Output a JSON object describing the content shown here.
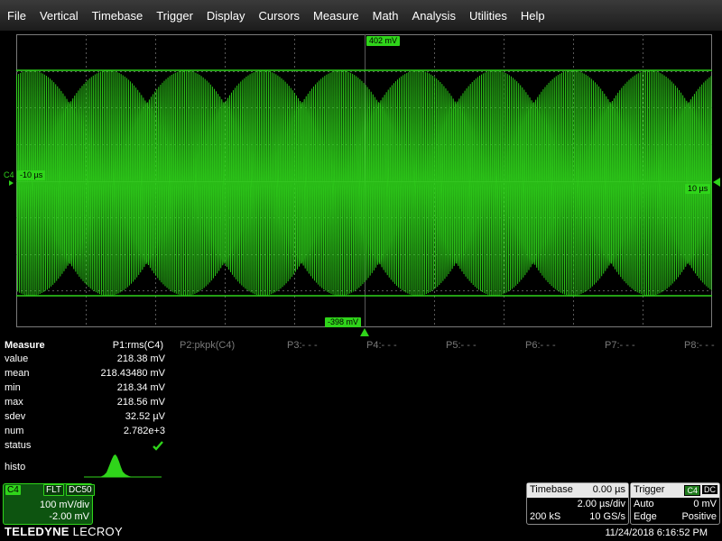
{
  "menu": [
    "File",
    "Vertical",
    "Timebase",
    "Trigger",
    "Display",
    "Cursors",
    "Measure",
    "Math",
    "Analysis",
    "Utilities",
    "Help"
  ],
  "grid": {
    "top_marker": "402 mV",
    "bottom_marker": "-398 mV",
    "channel_label": "C4",
    "left_time": "-10 µs",
    "right_time": "10 µs",
    "colors": {
      "trace": "#2fd41a",
      "grid": "#5a5a5a",
      "tag": "#2fd41a"
    }
  },
  "measure": {
    "title": "Measure",
    "p1": "P1:rms(C4)",
    "params": [
      "P2:pkpk(C4)",
      "P3:- - -",
      "P4:- - -",
      "P5:- - -",
      "P6:- - -",
      "P7:- - -",
      "P8:- - -"
    ],
    "rows": [
      {
        "label": "value",
        "value": "218.38 mV"
      },
      {
        "label": "mean",
        "value": "218.43480 mV"
      },
      {
        "label": "min",
        "value": "218.34 mV"
      },
      {
        "label": "max",
        "value": "218.56 mV"
      },
      {
        "label": "sdev",
        "value": "32.52 µV"
      },
      {
        "label": "num",
        "value": "2.782e+3"
      }
    ],
    "status_label": "status",
    "status_icon": "checkmark-icon",
    "histo_label": "histo"
  },
  "channel": {
    "name": "C4",
    "flt": "FLT",
    "coupling": "DC50",
    "vdiv": "100 mV/div",
    "offset": "-2.00 mV"
  },
  "logo": {
    "bold": "TELEDYNE",
    "rest": " LECROY"
  },
  "timebase": {
    "title": "Timebase",
    "delay": "0.00 µs",
    "tdiv": "2.00 µs/div",
    "samples": "200 kS",
    "rate": "10 GS/s"
  },
  "trigger": {
    "title": "Trigger",
    "source": "C4",
    "coupling": "DC",
    "mode": "Auto",
    "level": "0 mV",
    "type": "Edge",
    "slope": "Positive"
  },
  "datetime": "11/24/2018 6:16:52 PM"
}
